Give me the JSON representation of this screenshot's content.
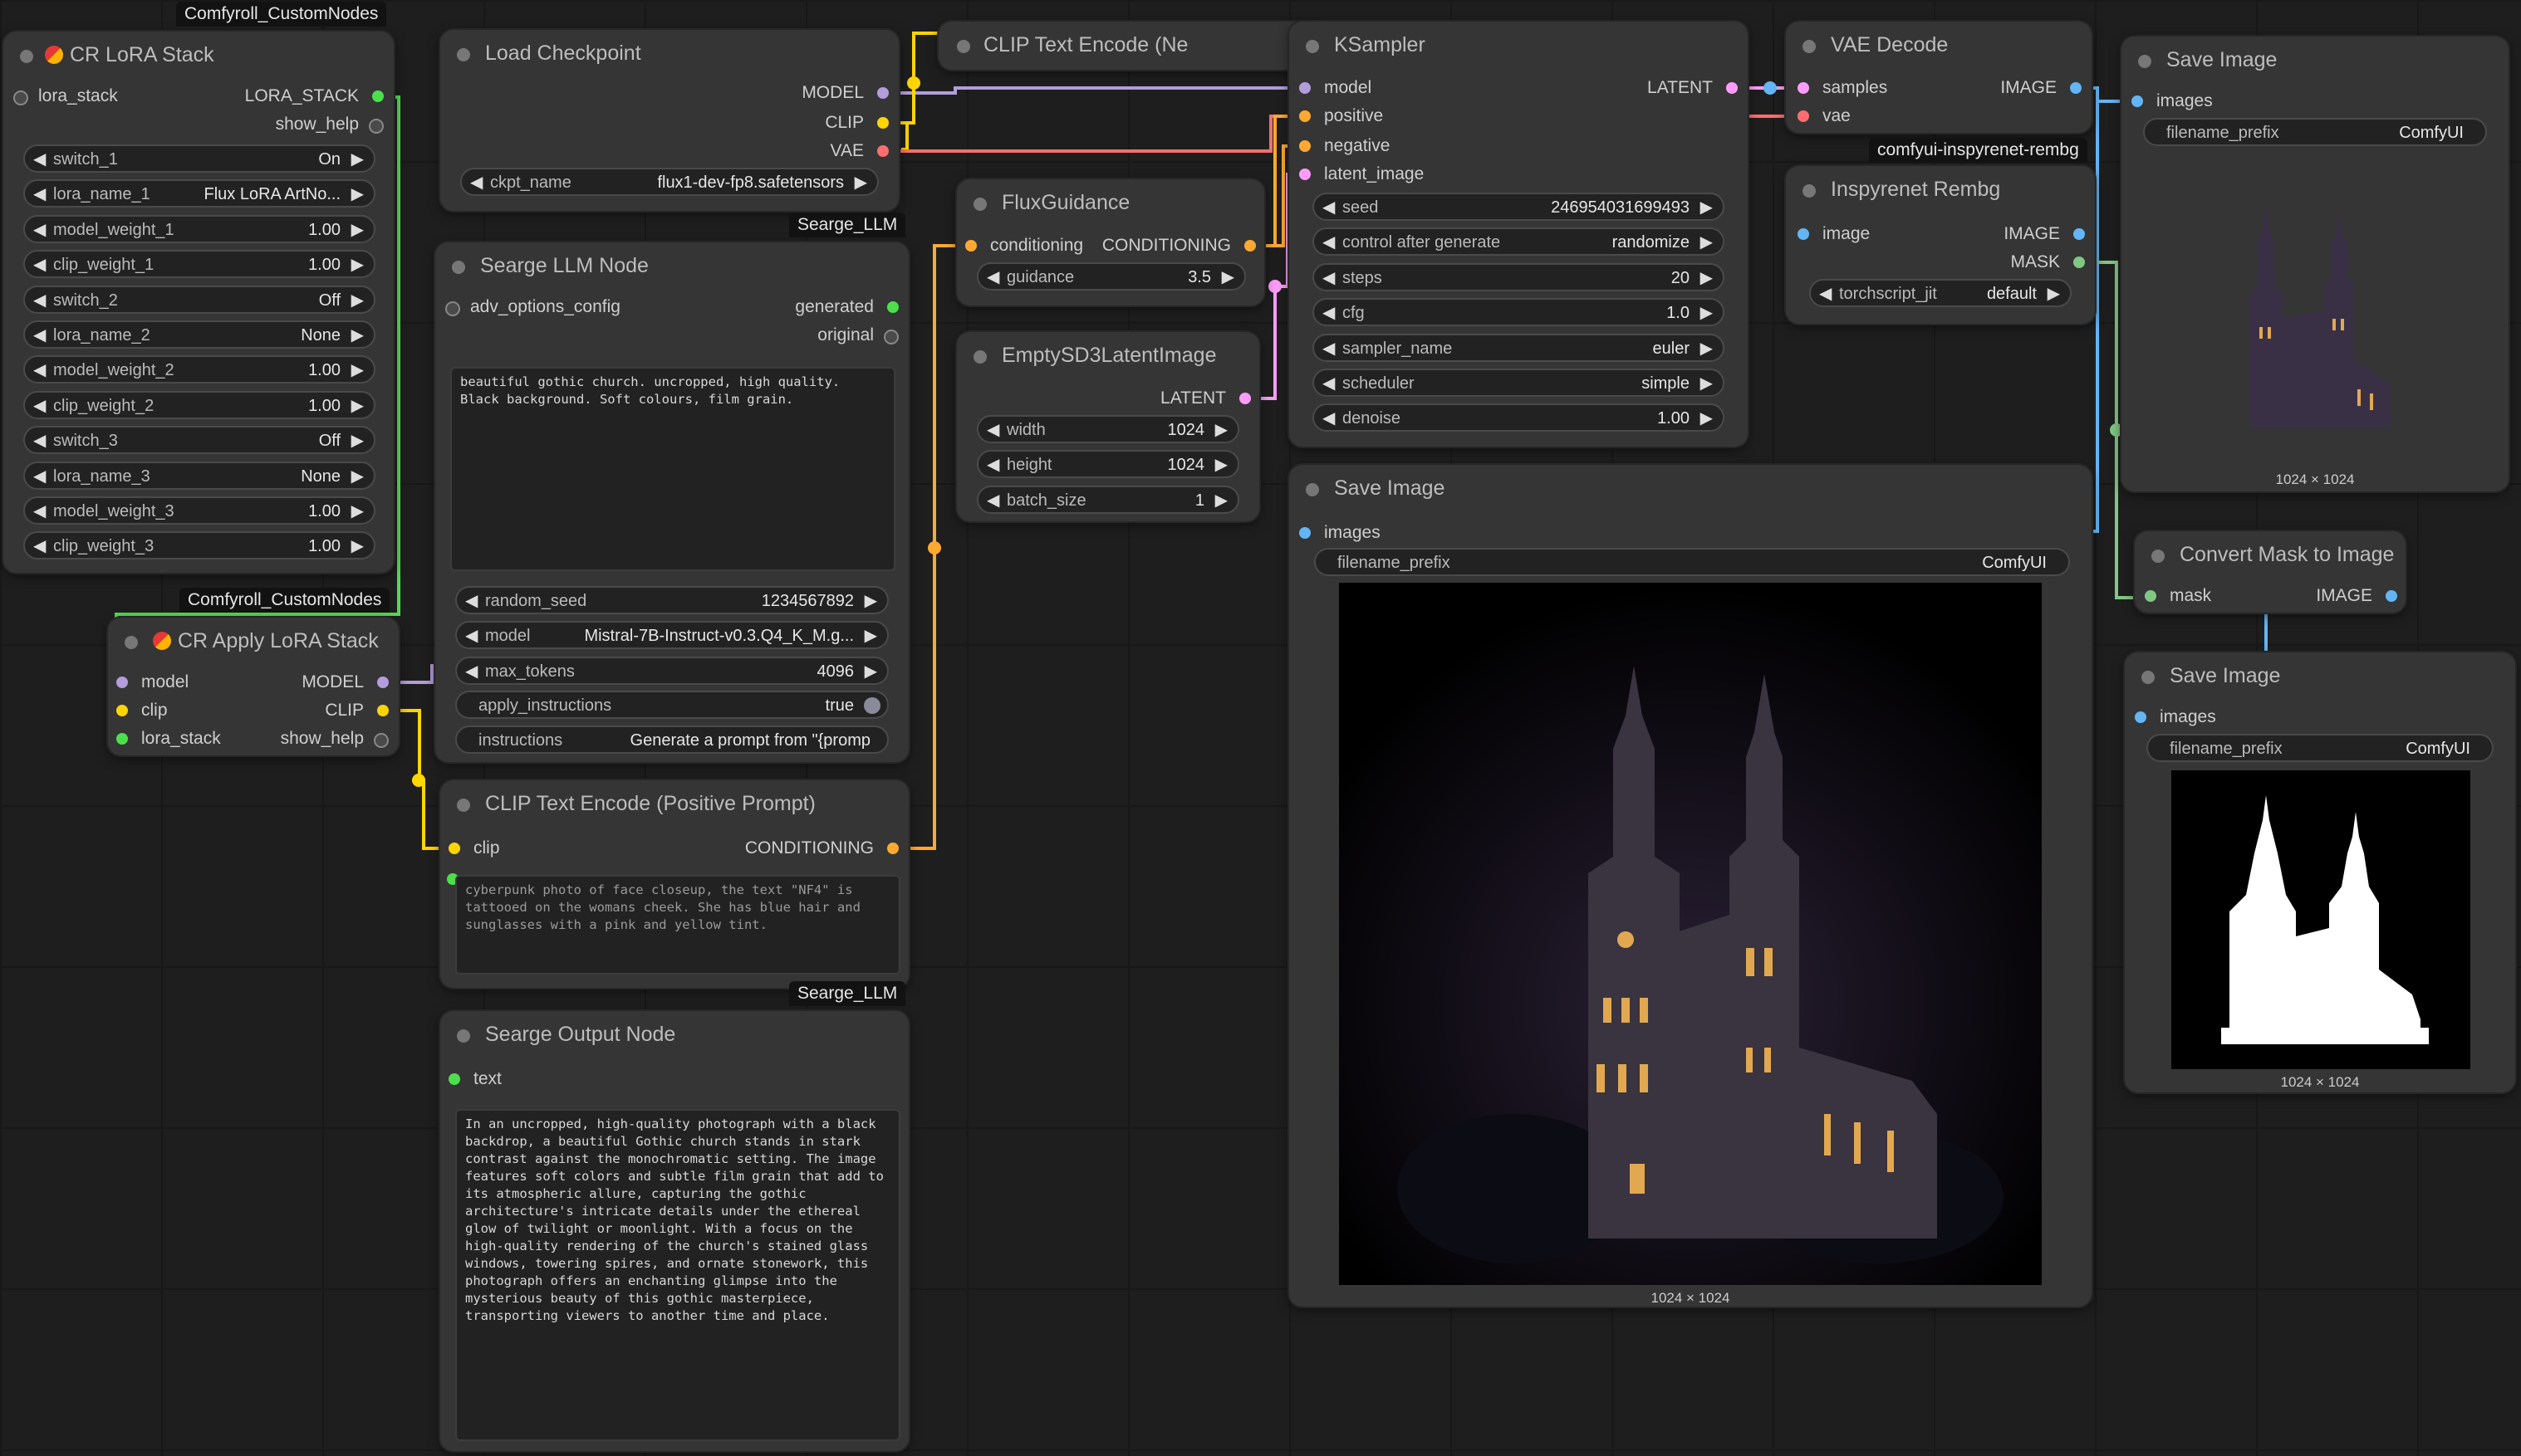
{
  "colors": {
    "model_pin": "#b39ddb",
    "clip_pin": "#ffd500",
    "vae_pin": "#ff6e6e",
    "conditioning_pin": "#ffa931",
    "latent_pin": "#ff9cf9",
    "image_pin": "#64b5f6",
    "mask_pin": "#81c784",
    "lora_pin": "#4be04b",
    "text_pin": "#4be04b"
  },
  "badges": {
    "comfyroll_1": "Comfyroll_CustomNodes",
    "comfyroll_2": "Comfyroll_CustomNodes",
    "searge_1": "Searge_LLM",
    "searge_2": "Searge_LLM",
    "inspyrenet": "comfyui-inspyrenet-rembg"
  },
  "lora_stack": {
    "title": "CR LoRA Stack",
    "input_label": "lora_stack",
    "output_label": "LORA_STACK",
    "output2_label": "show_help",
    "widgets": [
      {
        "label": "switch_1",
        "value": "On"
      },
      {
        "label": "lora_name_1",
        "value": "Flux LoRA ArtNo..."
      },
      {
        "label": "model_weight_1",
        "value": "1.00"
      },
      {
        "label": "clip_weight_1",
        "value": "1.00"
      },
      {
        "label": "switch_2",
        "value": "Off"
      },
      {
        "label": "lora_name_2",
        "value": "None"
      },
      {
        "label": "model_weight_2",
        "value": "1.00"
      },
      {
        "label": "clip_weight_2",
        "value": "1.00"
      },
      {
        "label": "switch_3",
        "value": "Off"
      },
      {
        "label": "lora_name_3",
        "value": "None"
      },
      {
        "label": "model_weight_3",
        "value": "1.00"
      },
      {
        "label": "clip_weight_3",
        "value": "1.00"
      }
    ]
  },
  "apply_lora": {
    "title": "CR Apply LoRA Stack",
    "inputs": [
      "model",
      "clip",
      "lora_stack"
    ],
    "outputs": [
      "MODEL",
      "CLIP",
      "show_help"
    ]
  },
  "load_checkpoint": {
    "title": "Load Checkpoint",
    "outputs": [
      "MODEL",
      "CLIP",
      "VAE"
    ],
    "ckpt_label": "ckpt_name",
    "ckpt_value": "flux1-dev-fp8.safetensors"
  },
  "llm_node": {
    "title": "Searge LLM Node",
    "input_label": "adv_options_config",
    "output_generated": "generated",
    "output_original": "original",
    "prompt_text": "beautiful gothic church. uncropped, high quality. Black background. Soft colours, film grain.",
    "widgets": [
      {
        "label": "random_seed",
        "value": "1234567892"
      },
      {
        "label": "model",
        "value": "Mistral-7B-Instruct-v0.3.Q4_K_M.g..."
      },
      {
        "label": "max_tokens",
        "value": "4096"
      }
    ],
    "apply_label": "apply_instructions",
    "apply_value": "true",
    "instructions_label": "instructions",
    "instructions_value": "Generate a prompt from \"{promp"
  },
  "clip_encode_top": {
    "title": "CLIP Text Encode (Ne"
  },
  "clip_encode_pos": {
    "title": "CLIP Text Encode (Positive Prompt)",
    "input_label": "clip",
    "output_label": "CONDITIONING",
    "text": "cyberpunk photo of face closeup, the text \"NF4\" is tattooed on the womans cheek. She has blue hair and sunglasses with a pink and yellow tint."
  },
  "output_node": {
    "title": "Searge Output Node",
    "input_label": "text",
    "text": "In an uncropped, high-quality photograph with a black backdrop, a beautiful Gothic church stands in stark contrast against the monochromatic setting. The image features soft colors and subtle film grain that add to its atmospheric allure, capturing the gothic architecture's intricate details under the ethereal glow of twilight or moonlight. With a focus on the high-quality rendering of the church's stained glass windows, towering spires, and ornate stonework, this photograph offers an enchanting glimpse into the mysterious beauty of this gothic masterpiece, transporting viewers to another time and place."
  },
  "flux_guidance": {
    "title": "FluxGuidance",
    "input_label": "conditioning",
    "output_label": "CONDITIONING",
    "widget_label": "guidance",
    "widget_value": "3.5"
  },
  "empty_latent": {
    "title": "EmptySD3LatentImage",
    "output_label": "LATENT",
    "widgets": [
      {
        "label": "width",
        "value": "1024"
      },
      {
        "label": "height",
        "value": "1024"
      },
      {
        "label": "batch_size",
        "value": "1"
      }
    ]
  },
  "ksampler": {
    "title": "KSampler",
    "inputs": [
      "model",
      "positive",
      "negative",
      "latent_image"
    ],
    "output_label": "LATENT",
    "widgets": [
      {
        "label": "seed",
        "value": "246954031699493"
      },
      {
        "label": "control after generate",
        "value": "randomize"
      },
      {
        "label": "steps",
        "value": "20"
      },
      {
        "label": "cfg",
        "value": "1.0"
      },
      {
        "label": "sampler_name",
        "value": "euler"
      },
      {
        "label": "scheduler",
        "value": "simple"
      },
      {
        "label": "denoise",
        "value": "1.00"
      }
    ]
  },
  "vae_decode": {
    "title": "VAE Decode",
    "inputs": [
      "samples",
      "vae"
    ],
    "output_label": "IMAGE"
  },
  "inspyrenet": {
    "title": "Inspyrenet Rembg",
    "input_label": "image",
    "outputs": [
      "IMAGE",
      "MASK"
    ],
    "widget_label": "torchscript_jit",
    "widget_value": "default"
  },
  "save_main": {
    "title": "Save Image",
    "input_label": "images",
    "prefix_label": "filename_prefix",
    "prefix_value": "ComfyUI",
    "dims": "1024 × 1024"
  },
  "save_top_right": {
    "title": "Save Image",
    "input_label": "images",
    "prefix_label": "filename_prefix",
    "prefix_value": "ComfyUI",
    "dims": "1024 × 1024"
  },
  "convert_mask": {
    "title": "Convert Mask to Image",
    "input_label": "mask",
    "output_label": "IMAGE"
  },
  "save_mask": {
    "title": "Save Image",
    "input_label": "images",
    "prefix_label": "filename_prefix",
    "prefix_value": "ComfyUI",
    "dims": "1024 × 1024"
  }
}
